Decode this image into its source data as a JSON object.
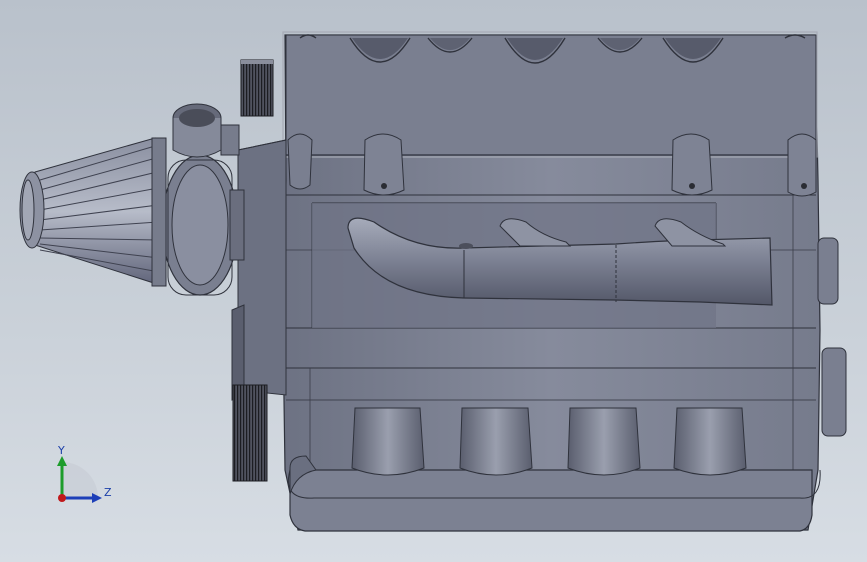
{
  "viewport": {
    "background_top": "#b9c1cb",
    "background_bottom": "#d7dde4",
    "model_color": "#7c8192",
    "model_dark": "#4d5160",
    "model_light": "#a4a9b8"
  },
  "triad": {
    "y_label": "Y",
    "z_label": "Z",
    "y_color": "#1d9c2b",
    "z_color": "#1d3fb8",
    "x_color": "#c0191b"
  }
}
